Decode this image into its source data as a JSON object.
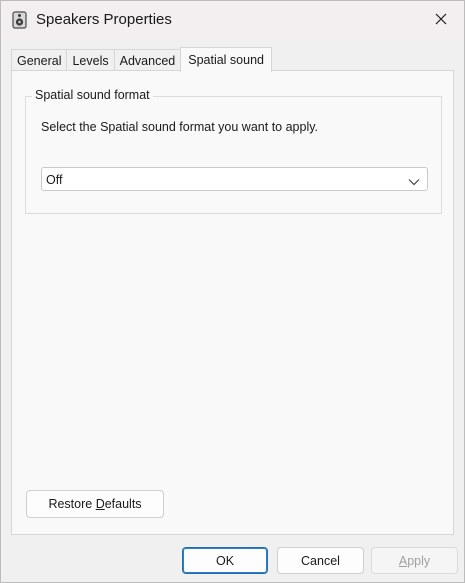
{
  "window": {
    "title": "Speakers Properties",
    "title_icon": "speaker-icon",
    "close_icon": "close-icon"
  },
  "tabs": [
    {
      "label": "General",
      "active": false
    },
    {
      "label": "Levels",
      "active": false
    },
    {
      "label": "Advanced",
      "active": false
    },
    {
      "label": "Spatial sound",
      "active": true
    }
  ],
  "spatial": {
    "group_title": "Spatial sound format",
    "description": "Select the Spatial sound format you want to apply.",
    "format_selected": "Off",
    "dropdown_icon": "chevron-down-icon"
  },
  "restore": {
    "prefix": "Restore ",
    "mnemonic": "D",
    "suffix": "efaults"
  },
  "buttons": {
    "ok": "OK",
    "cancel": "Cancel",
    "apply_mnemonic": "A",
    "apply_rest": "pply"
  },
  "colors": {
    "titlebar": "#f3eef0",
    "dialog_bg": "#f0f0f0",
    "panel_bg": "#f9f9f9",
    "accent": "#1f6fb4"
  }
}
